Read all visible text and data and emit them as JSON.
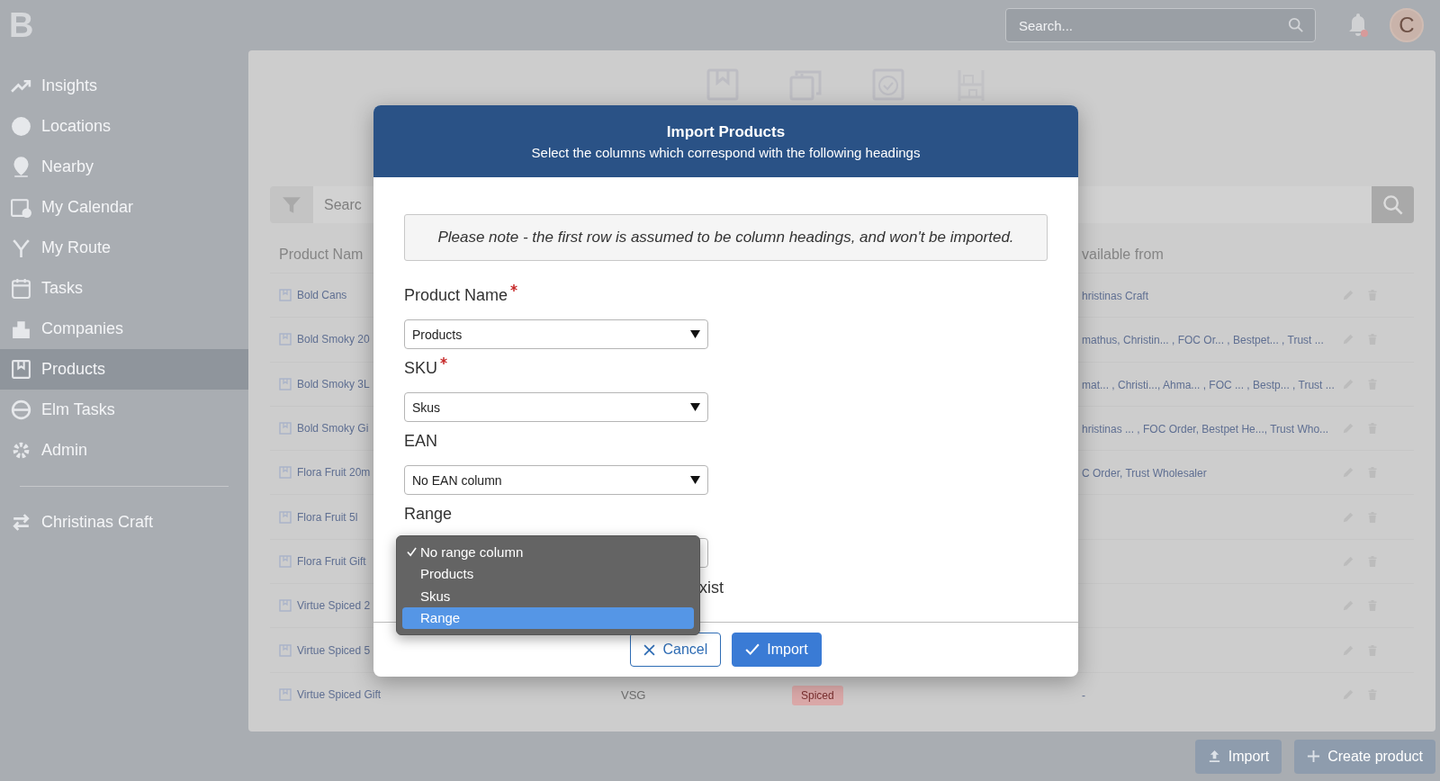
{
  "app": {
    "logo": "B"
  },
  "top_bar": {
    "search": {
      "placeholder": "Search..."
    },
    "avatar": "C"
  },
  "sidebar": {
    "items": [
      {
        "label": "Insights",
        "selected": false
      },
      {
        "label": "Locations",
        "selected": false
      },
      {
        "label": "Nearby",
        "selected": false
      },
      {
        "label": "My Calendar",
        "selected": false
      },
      {
        "label": "My Route",
        "selected": false
      },
      {
        "label": "Tasks",
        "selected": false
      },
      {
        "label": "Companies",
        "selected": false
      },
      {
        "label": "Products",
        "selected": true
      },
      {
        "label": "Elm Tasks",
        "selected": false
      },
      {
        "label": "Admin",
        "selected": false
      }
    ],
    "account": {
      "label": "Christinas Craft"
    }
  },
  "filter": {
    "search_placeholder": "Searc"
  },
  "table": {
    "columns": [
      "Product Nam",
      "vailable from"
    ],
    "rows": [
      {
        "name": "Bold Cans",
        "available": "hristinas Craft"
      },
      {
        "name": "Bold Smoky 20",
        "available": "mathus,  Christin... , FOC Or... , Bestpet... , Trust ..."
      },
      {
        "name": "Bold Smoky 3L",
        "available": "mat... , Christi..., Ahma... , FOC ...  , Bestp... , Trust ..."
      },
      {
        "name": "Bold Smoky Gi",
        "available": "hristinas ... , FOC Order,  Bestpet He..., Trust Who..."
      },
      {
        "name": "Flora Fruit 20m",
        "available": "C Order,  Trust Wholesaler"
      },
      {
        "name": "Flora Fruit 5l"
      },
      {
        "name": "Flora Fruit Gift"
      },
      {
        "name": "Virtue Spiced 2"
      },
      {
        "name": "Virtue Spiced 5"
      },
      {
        "name": "Virtue Spiced Gift",
        "code": "VSG",
        "tag": "Spiced",
        "available": "-"
      }
    ]
  },
  "bottom_actions": [
    "Import",
    "Create product"
  ],
  "modal": {
    "title": "Import Products",
    "subtitle": "Select the columns which correspond with the following headings",
    "note": "Please note - the first row is assumed to be column headings, and won't be imported.",
    "fields": [
      {
        "label": "Product Name",
        "required": true,
        "value": "Products"
      },
      {
        "label": "SKU",
        "required": true,
        "value": "Skus"
      },
      {
        "label": "EAN",
        "required": false,
        "value": "No EAN column"
      },
      {
        "label": "Range",
        "required": false
      }
    ],
    "option_tail": "xist",
    "cancel_button": "Cancel",
    "import_button": "Import"
  },
  "dropdown": {
    "options": [
      {
        "label": "No range column",
        "checked": true,
        "selected": false
      },
      {
        "label": "Products",
        "checked": false,
        "selected": false
      },
      {
        "label": "Skus",
        "checked": false,
        "selected": false
      },
      {
        "label": "Range",
        "checked": false,
        "selected": true
      }
    ]
  }
}
